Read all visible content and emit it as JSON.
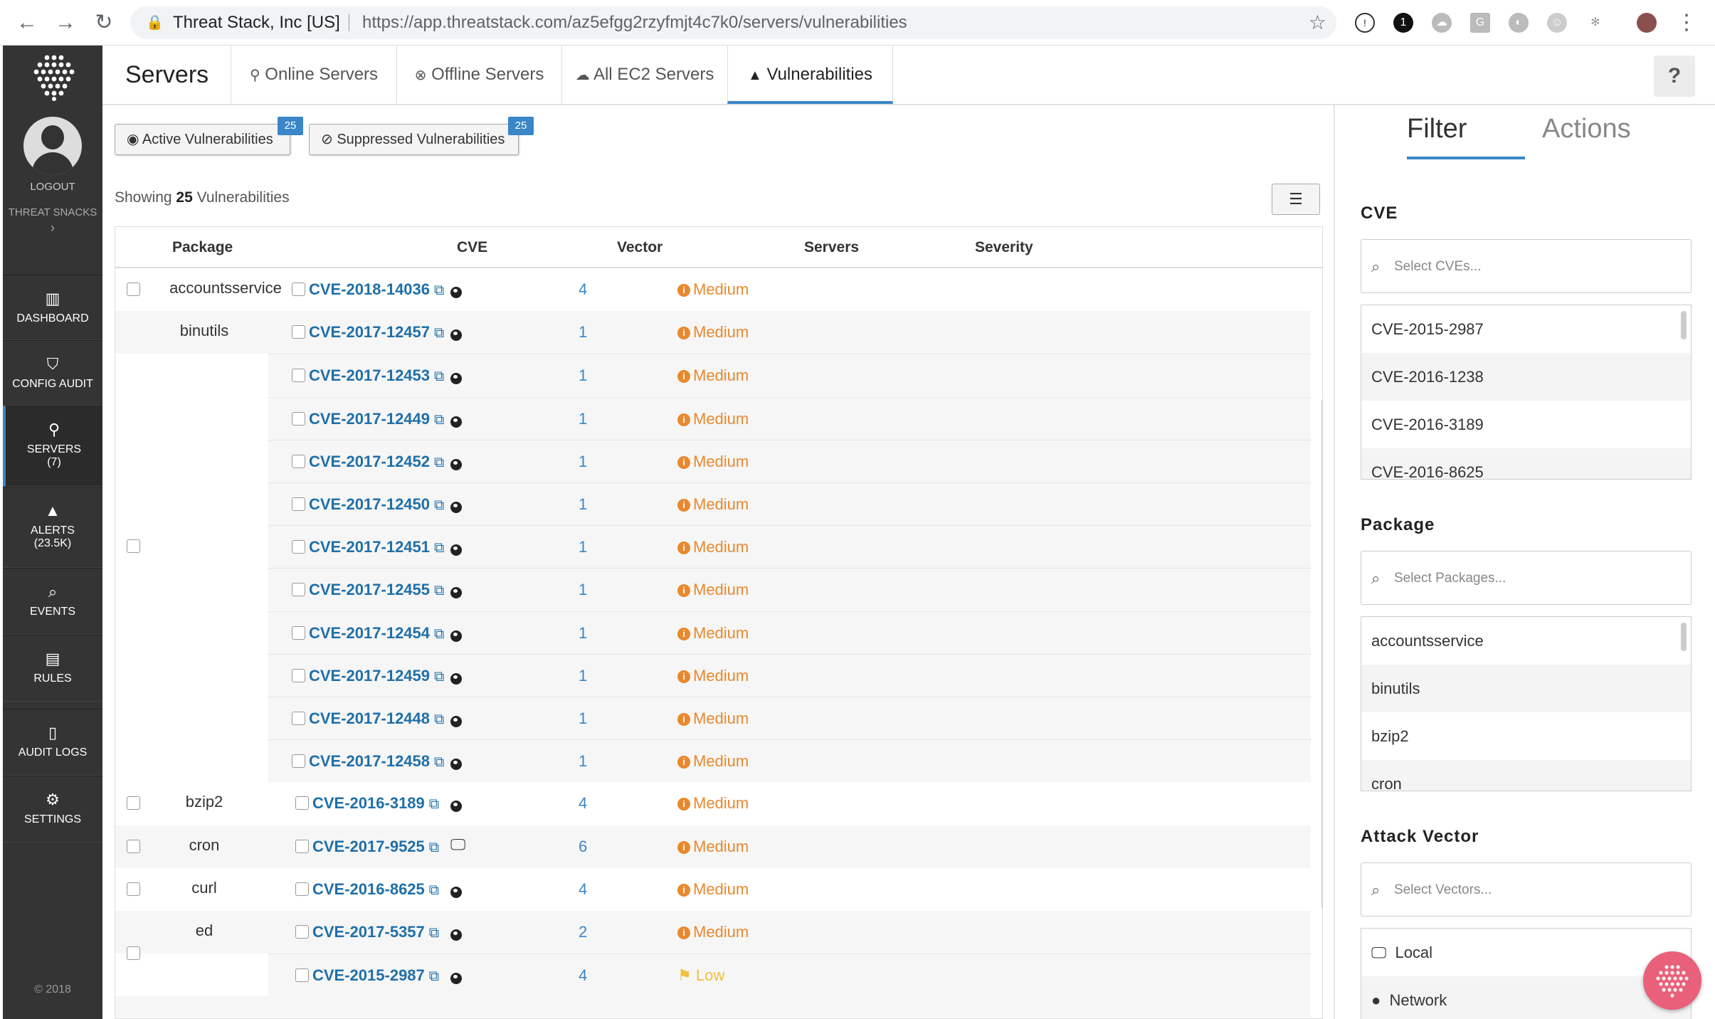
{
  "browser": {
    "site_label": "Threat Stack, Inc [US]",
    "url_host": "https://app.threatstack.com",
    "url_path": "/az5efgg2rzyfmjt4c7k0/servers/vulnerabilities"
  },
  "sidebar": {
    "logout": "LOGOUT",
    "org": "THREAT SNACKS",
    "org_arrow": "›",
    "copyright": "© 2018",
    "items": [
      {
        "label": "DASHBOARD",
        "icon": "bar-chart-icon"
      },
      {
        "label": "CONFIG AUDIT",
        "icon": "shield-icon"
      },
      {
        "label": "SERVERS",
        "sub": "(7)",
        "icon": "sitemap-icon"
      },
      {
        "label": "ALERTS",
        "sub": "(23.5K)",
        "icon": "warning-icon"
      },
      {
        "label": "EVENTS",
        "icon": "search-icon"
      },
      {
        "label": "RULES",
        "icon": "clipboard-icon"
      },
      {
        "label": "AUDIT LOGS",
        "icon": "file-icon"
      },
      {
        "label": "SETTINGS",
        "icon": "gears-icon"
      }
    ]
  },
  "header": {
    "title": "Servers",
    "tabs": [
      "Online Servers",
      "Offline Servers",
      "All EC2 Servers",
      "Vulnerabilities"
    ],
    "active_tab": "Vulnerabilities",
    "help": "?"
  },
  "main": {
    "active_btn": "Active Vulnerabilities",
    "active_count": "25",
    "suppressed_btn": "Suppressed Vulnerabilities",
    "suppressed_count": "25",
    "showing_prefix": "Showing",
    "showing_count": "25",
    "showing_suffix": "Vulnerabilities"
  },
  "table": {
    "headers": [
      "Package",
      "CVE",
      "Vector",
      "Servers",
      "Severity"
    ],
    "groups": [
      {
        "package": "accountsservice",
        "rows": [
          {
            "cve": "CVE-2018-14036",
            "vector": "network",
            "servers": "4",
            "severity": "Medium"
          }
        ]
      },
      {
        "package": "binutils",
        "rows": [
          {
            "cve": "CVE-2017-12457",
            "vector": "network",
            "servers": "1",
            "severity": "Medium"
          },
          {
            "cve": "CVE-2017-12453",
            "vector": "network",
            "servers": "1",
            "severity": "Medium"
          },
          {
            "cve": "CVE-2017-12449",
            "vector": "network",
            "servers": "1",
            "severity": "Medium"
          },
          {
            "cve": "CVE-2017-12452",
            "vector": "network",
            "servers": "1",
            "severity": "Medium"
          },
          {
            "cve": "CVE-2017-12450",
            "vector": "network",
            "servers": "1",
            "severity": "Medium"
          },
          {
            "cve": "CVE-2017-12451",
            "vector": "network",
            "servers": "1",
            "severity": "Medium"
          },
          {
            "cve": "CVE-2017-12455",
            "vector": "network",
            "servers": "1",
            "severity": "Medium"
          },
          {
            "cve": "CVE-2017-12454",
            "vector": "network",
            "servers": "1",
            "severity": "Medium"
          },
          {
            "cve": "CVE-2017-12459",
            "vector": "network",
            "servers": "1",
            "severity": "Medium"
          },
          {
            "cve": "CVE-2017-12448",
            "vector": "network",
            "servers": "1",
            "severity": "Medium"
          },
          {
            "cve": "CVE-2017-12458",
            "vector": "network",
            "servers": "1",
            "severity": "Medium"
          }
        ]
      },
      {
        "package": "bzip2",
        "rows": [
          {
            "cve": "CVE-2016-3189",
            "vector": "network",
            "servers": "4",
            "severity": "Medium"
          }
        ]
      },
      {
        "package": "cron",
        "rows": [
          {
            "cve": "CVE-2017-9525",
            "vector": "local",
            "servers": "6",
            "severity": "Medium"
          }
        ]
      },
      {
        "package": "curl",
        "rows": [
          {
            "cve": "CVE-2016-8625",
            "vector": "network",
            "servers": "4",
            "severity": "Medium"
          }
        ]
      },
      {
        "package": "ed",
        "rows": [
          {
            "cve": "CVE-2017-5357",
            "vector": "network",
            "servers": "2",
            "severity": "Medium"
          },
          {
            "cve": "CVE-2015-2987",
            "vector": "network",
            "servers": "4",
            "severity": "Low"
          }
        ]
      }
    ]
  },
  "filter_panel": {
    "tabs": [
      "Filter",
      "Actions"
    ],
    "cve_title": "CVE",
    "cve_placeholder": "Select CVEs...",
    "cve_options": [
      "CVE-2015-2987",
      "CVE-2016-1238",
      "CVE-2016-3189",
      "CVE-2016-8625"
    ],
    "package_title": "Package",
    "package_placeholder": "Select Packages...",
    "package_options": [
      "accountsservice",
      "binutils",
      "bzip2",
      "cron"
    ],
    "vector_title": "Attack Vector",
    "vector_placeholder": "Select Vectors...",
    "vector_options": [
      "Local",
      "Network"
    ]
  },
  "colors": {
    "accent": "#3a86c8",
    "sidebar_bg": "#343434",
    "severity_medium": "#e8892f",
    "severity_low": "#f0c040",
    "link": "#1f6fa8"
  }
}
